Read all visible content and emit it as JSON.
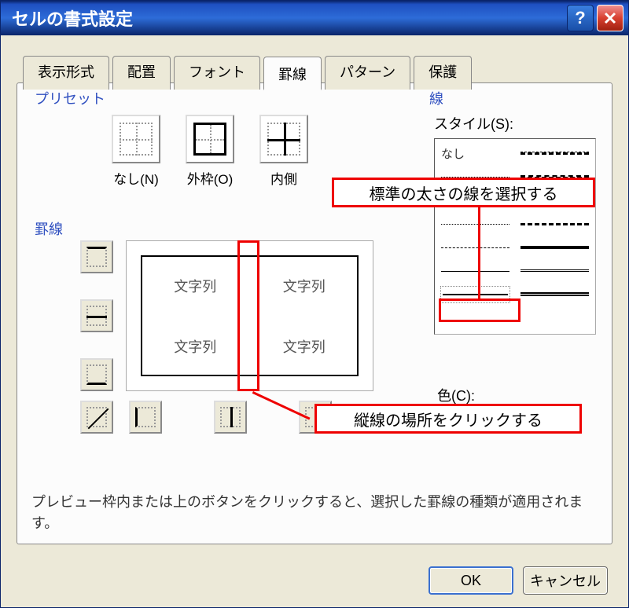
{
  "title": "セルの書式設定",
  "tabs": [
    "表示形式",
    "配置",
    "フォント",
    "罫線",
    "パターン",
    "保護"
  ],
  "active_tab": 3,
  "groups": {
    "preset": "プリセット",
    "border": "罫線",
    "line": "線"
  },
  "preset": {
    "none": "なし(N)",
    "outer": "外枠(O)",
    "inner": "内側"
  },
  "preview_text": "文字列",
  "style_label": "スタイル(S):",
  "style_none": "なし",
  "color_label": "色(C):",
  "hint_text": "プレビュー枠内または上のボタンをクリックすると、選択した罫線の種類が適用されます。",
  "buttons": {
    "ok": "OK",
    "cancel": "キャンセル"
  },
  "annotations": {
    "select_line": "標準の太さの線を選択する",
    "click_vertical": "縦線の場所をクリックする"
  }
}
